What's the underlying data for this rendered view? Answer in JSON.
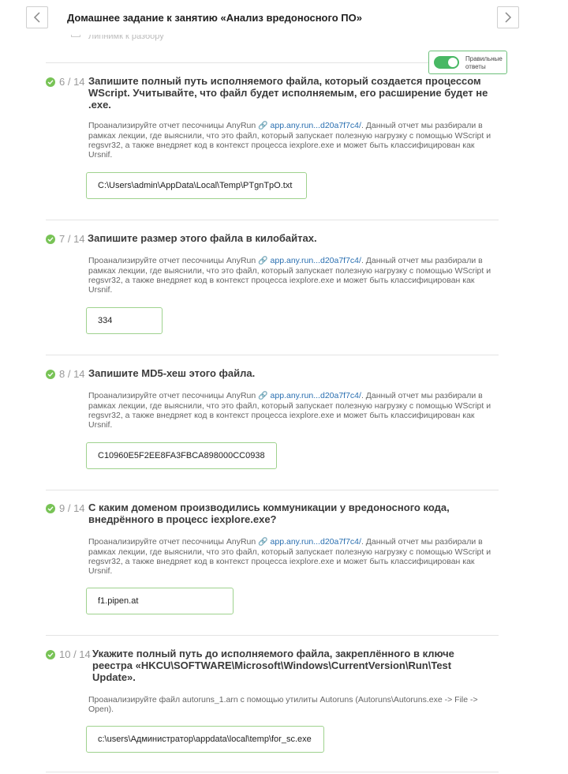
{
  "header": {
    "title": "Домашнее задание к занятию «Анализ вредоносного ПО»",
    "prev_icon": "chevron-left-icon",
    "next_icon": "chevron-right-icon"
  },
  "previous_question_remnant": "Липнимк к разбору",
  "toggle": {
    "label": "Правильные ответы",
    "enabled": true,
    "color": "#48b864"
  },
  "desc_template": {
    "prefix": "Проанализируйте отчет песочницы AnyRun",
    "link": "app.any.run...d20a7f7c4/",
    "suffix": ". Данный отчет мы разбирали в рамках лекции, где выяснили, что это файл, который запускает полезную нагрузку с помощью WScript и regsvr32, а также внедряет код в контекст процесса iexplore.exe и может быть классифицирован как Ursnif."
  },
  "questions": [
    {
      "number": "6 / 14",
      "title": "Запишите полный путь исполняемого файла, который создается процессом WScript. Учитывайте, что файл будет исполняемым, его расширение будет не .exe.",
      "answer": "C:\\Users\\admin\\AppData\\Local\\Temp\\PTgnTpO.txt"
    },
    {
      "number": "7 / 14",
      "title": "Запишите размер этого файла в килобайтах.",
      "answer": "334"
    },
    {
      "number": "8 / 14",
      "title": "Запишите MD5-хеш этого файла.",
      "answer": "C10960E5F2EE8FA3FBCA898000CC0938"
    },
    {
      "number": "9 / 14",
      "title": "С каким доменом производились коммуникации у вредоносного кода, внедрённого в процесс iexplore.exe?",
      "answer": "f1.pipen.at"
    },
    {
      "number": "10 / 14",
      "title": "Укажите полный путь до исполняемого файла, закреплённого в ключе реестра «HKCU\\SOFTWARE\\Microsoft\\Windows\\CurrentVersion\\Run\\Test Update».",
      "description": "Проанализируйте файл autoruns_1.arn с помощью утилиты Autoruns (Autoruns\\Autoruns.exe -> File -> Open).",
      "answer": "c:\\users\\Администратор\\appdata\\local\\temp\\for_sc.exe"
    }
  ],
  "colors": {
    "check": "#78c356",
    "answer_border": "#9fd28e",
    "link": "#2a6fb0"
  }
}
